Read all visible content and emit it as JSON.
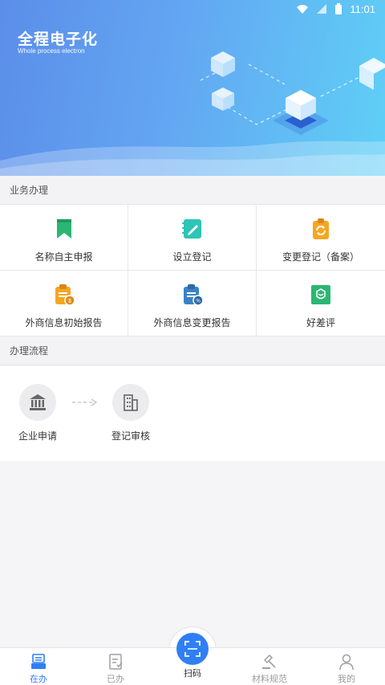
{
  "statusbar": {
    "time": "11:01"
  },
  "banner": {
    "title": "全程电子化",
    "subtitle": "Whole process electron"
  },
  "sections": {
    "business": "业务办理",
    "process": "办理流程"
  },
  "services": [
    {
      "label": "名称自主申报",
      "icon": "bookmark-icon",
      "color": "#2bb673"
    },
    {
      "label": "设立登记",
      "icon": "edit-note-icon",
      "color": "#2ec4b6"
    },
    {
      "label": "变更登记（备案）",
      "icon": "clipboard-refresh-icon",
      "color": "#f5a623"
    },
    {
      "label": "外商信息初始报告",
      "icon": "clipboard-report-icon",
      "color": "#f5a623"
    },
    {
      "label": "外商信息变更报告",
      "icon": "clipboard-change-icon",
      "color": "#3b82c4"
    },
    {
      "label": "好差评",
      "icon": "rating-icon",
      "color": "#2bb673"
    }
  ],
  "process_steps": [
    {
      "label": "企业申请",
      "icon": "bank-icon"
    },
    {
      "label": "登记审核",
      "icon": "building-icon"
    }
  ],
  "tabs": [
    {
      "label": "在办",
      "icon": "inbox-icon",
      "active": true
    },
    {
      "label": "已办",
      "icon": "done-doc-icon",
      "active": false
    },
    {
      "label": "扫码",
      "icon": "scan-icon",
      "active": false
    },
    {
      "label": "材料规范",
      "icon": "gavel-icon",
      "active": false
    },
    {
      "label": "我的",
      "icon": "user-icon",
      "active": false
    }
  ],
  "colors": {
    "accent": "#2f7ff5"
  }
}
